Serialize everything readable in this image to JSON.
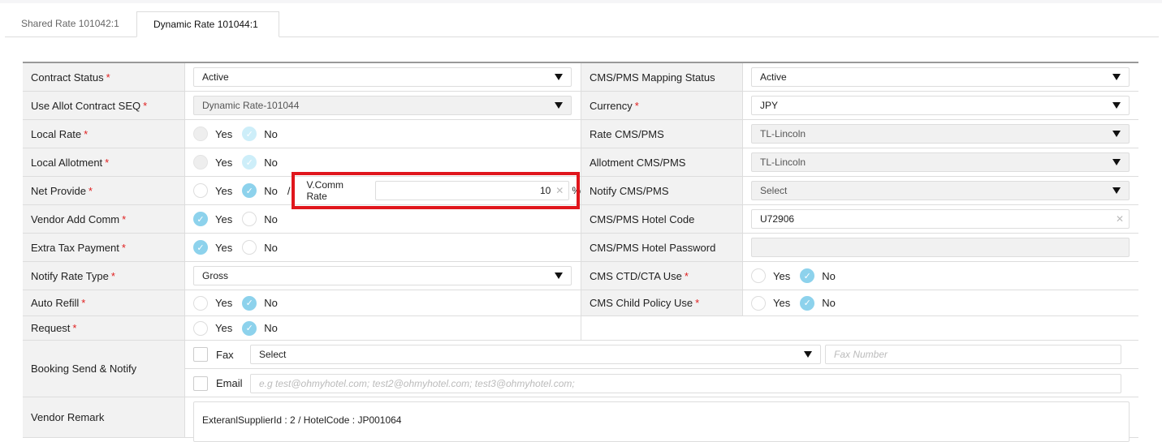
{
  "tabs": [
    {
      "label": "Shared Rate 101042:1"
    },
    {
      "label": "Dynamic Rate 101044:1"
    }
  ],
  "left": {
    "contract_status": {
      "label": "Contract Status",
      "value": "Active"
    },
    "use_allot": {
      "label": "Use Allot Contract SEQ",
      "value": "Dynamic Rate-101044"
    },
    "local_rate": {
      "label": "Local Rate",
      "selected": "No"
    },
    "local_allotment": {
      "label": "Local Allotment",
      "selected": "No"
    },
    "net_provide": {
      "label": "Net Provide",
      "selected": "No",
      "separator": "/",
      "vcomm_label": "V.Comm Rate",
      "vcomm_value": "10",
      "unit": "%"
    },
    "vendor_add_comm": {
      "label": "Vendor Add Comm",
      "selected": "Yes"
    },
    "extra_tax": {
      "label": "Extra Tax Payment",
      "selected": "Yes"
    },
    "notify_rate_type": {
      "label": "Notify Rate Type",
      "value": "Gross"
    },
    "auto_refill": {
      "label": "Auto Refill",
      "selected": "No"
    },
    "request": {
      "label": "Request",
      "selected": "No"
    },
    "booking": {
      "label": "Booking Send & Notify",
      "fax_label": "Fax",
      "fax_select": "Select",
      "fax_placeholder": "Fax Number",
      "email_label": "Email",
      "email_placeholder": "e.g test@ohmyhotel.com; test2@ohmyhotel.com; test3@ohmyhotel.com;"
    },
    "vendor_remark": {
      "label": "Vendor Remark",
      "value": "ExteranlSupplierId : 2 / HotelCode : JP001064"
    }
  },
  "right": {
    "mapping_status": {
      "label": "CMS/PMS Mapping Status",
      "value": "Active"
    },
    "currency": {
      "label": "Currency",
      "value": "JPY"
    },
    "rate_cms": {
      "label": "Rate CMS/PMS",
      "value": "TL-Lincoln"
    },
    "allot_cms": {
      "label": "Allotment CMS/PMS",
      "value": "TL-Lincoln"
    },
    "notify_cms": {
      "label": "Notify CMS/PMS",
      "value": "Select"
    },
    "hotel_code": {
      "label": "CMS/PMS Hotel Code",
      "value": "U72906"
    },
    "hotel_password": {
      "label": "CMS/PMS Hotel Password",
      "value": ""
    },
    "ctd_cta": {
      "label": "CMS CTD/CTA Use",
      "selected": "No"
    },
    "child_policy": {
      "label": "CMS Child Policy Use",
      "selected": "No"
    }
  },
  "common": {
    "yes": "Yes",
    "no": "No",
    "required": "*"
  },
  "colors": {
    "accent": "#8dd2ec",
    "required": "#e02020",
    "highlight": "#e0161c"
  }
}
